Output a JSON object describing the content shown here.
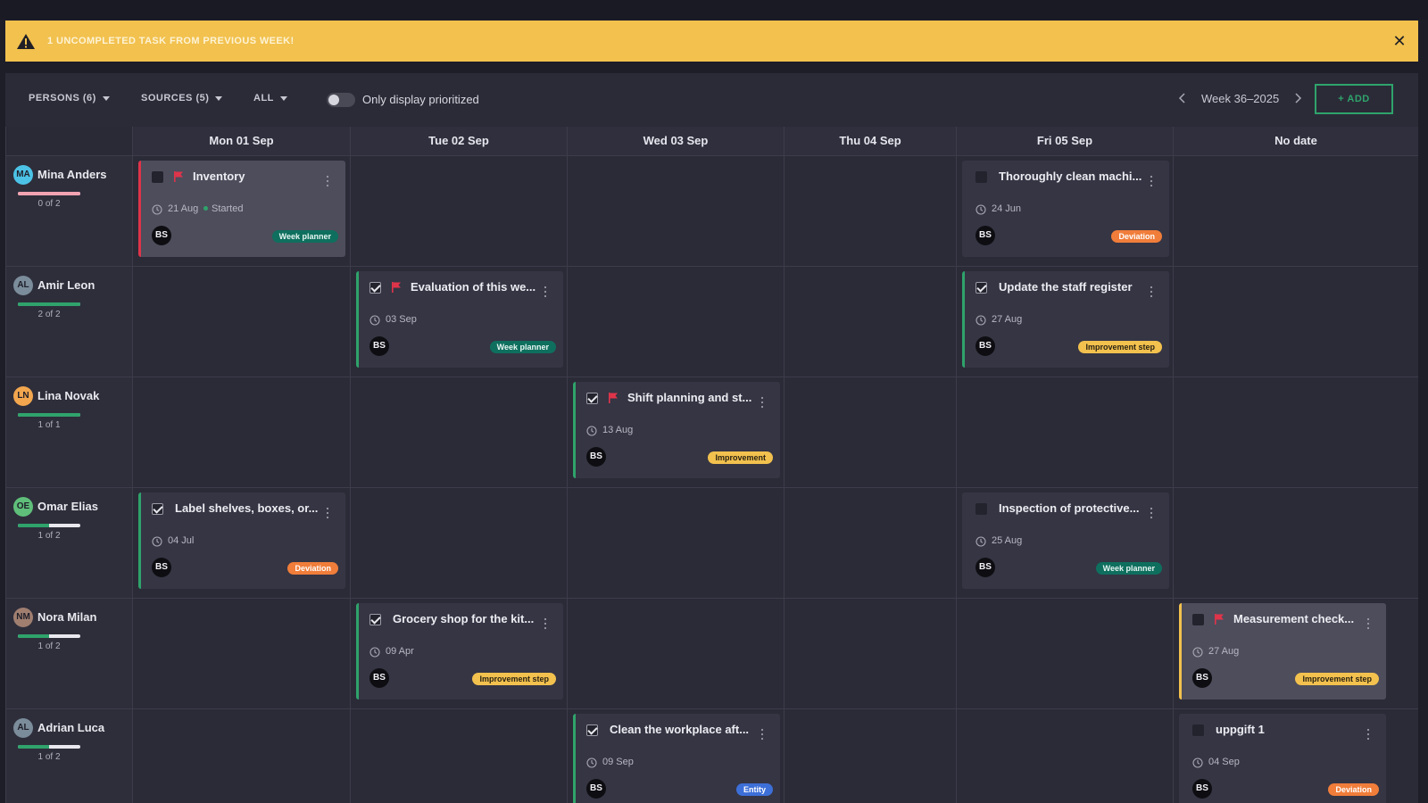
{
  "banner": {
    "text": "1 UNCOMPLETED TASK FROM PREVIOUS WEEK!",
    "close": "✕"
  },
  "toolbar": {
    "persons": "PERSONS (6)",
    "sources": "SOURCES (5)",
    "all": "ALL",
    "toggle_label": "Only display prioritized",
    "week": "Week 36–2025",
    "add": "+ ADD"
  },
  "days": [
    "Mon 01 Sep",
    "Tue 02 Sep",
    "Wed 03 Sep",
    "Thu 04 Sep",
    "Fri 05 Sep",
    "No date"
  ],
  "colors": {
    "accent_green": "#2fa36b",
    "priority_red": "#e0344a",
    "warning_yellow": "#f2c14e",
    "tag_teal": "#0f6f5e",
    "tag_orange": "#f07d3a",
    "tag_blue": "#3d6fd8"
  },
  "persons": [
    {
      "initials": "MA",
      "name": "Mina Anders",
      "count": "0 of 2",
      "progress": 0,
      "avatar_color": "#4cc3e6",
      "bar_color": "#f2a3b1"
    },
    {
      "initials": "AL",
      "name": "Amir Leon",
      "count": "2 of 2",
      "progress": 1,
      "avatar_color": "#7b8c9a",
      "bar_color": "#2fa36b"
    },
    {
      "initials": "LN",
      "name": "Lina Novak",
      "count": "1 of 1",
      "progress": 1,
      "avatar_color": "#f2a64e",
      "bar_color": "#2fa36b"
    },
    {
      "initials": "OE",
      "name": "Omar Elias",
      "count": "1 of 2",
      "progress": 0.5,
      "avatar_color": "#5fbf7a",
      "bar_color": "#2fa36b"
    },
    {
      "initials": "NM",
      "name": "Nora Milan",
      "count": "1 of 2",
      "progress": 0.5,
      "avatar_color": "#a07f70",
      "bar_color": "#2fa36b"
    },
    {
      "initials": "AL",
      "name": "Adrian Luca",
      "count": "1 of 2",
      "progress": 0.5,
      "avatar_color": "#7b8c9a",
      "bar_color": "#2fa36b"
    }
  ],
  "tasks": [
    {
      "row": 0,
      "day": 0,
      "title": "Inventory",
      "date": "21 Aug",
      "status": "Started",
      "done": false,
      "priority": true,
      "style": "red",
      "assignee": "BS",
      "tag": "Week planner",
      "tag_style": "teal"
    },
    {
      "row": 0,
      "day": 4,
      "title": "Thoroughly clean machi...",
      "date": "24 Jun",
      "done": false,
      "priority": false,
      "style": "none",
      "assignee": "BS",
      "tag": "Deviation",
      "tag_style": "orange"
    },
    {
      "row": 1,
      "day": 1,
      "title": "Evaluation of this we...",
      "date": "03 Sep",
      "done": true,
      "priority": true,
      "style": "green",
      "assignee": "BS",
      "tag": "Week planner",
      "tag_style": "teal"
    },
    {
      "row": 1,
      "day": 4,
      "title": "Update the staff register",
      "date": "27 Aug",
      "done": true,
      "priority": false,
      "style": "green",
      "assignee": "BS",
      "tag": "Improvement step",
      "tag_style": "yellowt"
    },
    {
      "row": 2,
      "day": 2,
      "title": "Shift planning and st...",
      "date": "13 Aug",
      "done": true,
      "priority": true,
      "style": "green",
      "assignee": "BS",
      "tag": "Improvement",
      "tag_style": "yellowt"
    },
    {
      "row": 3,
      "day": 0,
      "title": "Label shelves, boxes, or...",
      "date": "04 Jul",
      "done": true,
      "priority": false,
      "style": "green",
      "assignee": "BS",
      "tag": "Deviation",
      "tag_style": "orange"
    },
    {
      "row": 3,
      "day": 4,
      "title": "Inspection of protective...",
      "date": "25 Aug",
      "done": false,
      "priority": false,
      "style": "none",
      "assignee": "BS",
      "tag": "Week planner",
      "tag_style": "teal"
    },
    {
      "row": 4,
      "day": 1,
      "title": "Grocery shop for the kit...",
      "date": "09 Apr",
      "done": true,
      "priority": false,
      "style": "green",
      "assignee": "BS",
      "tag": "Improvement step",
      "tag_style": "yellowt"
    },
    {
      "row": 4,
      "day": 5,
      "title": "Measurement check...",
      "date": "27 Aug",
      "done": false,
      "priority": true,
      "style": "yellow",
      "assignee": "BS",
      "tag": "Improvement step",
      "tag_style": "yellowt"
    },
    {
      "row": 5,
      "day": 2,
      "title": "Clean the workplace aft...",
      "date": "09 Sep",
      "done": true,
      "priority": false,
      "style": "green",
      "assignee": "BS",
      "tag": "Entity",
      "tag_style": "blue"
    },
    {
      "row": 5,
      "day": 5,
      "title": "uppgift 1",
      "date": "04 Sep",
      "done": false,
      "priority": false,
      "style": "none",
      "assignee": "BS",
      "tag": "Deviation",
      "tag_style": "orange"
    }
  ]
}
